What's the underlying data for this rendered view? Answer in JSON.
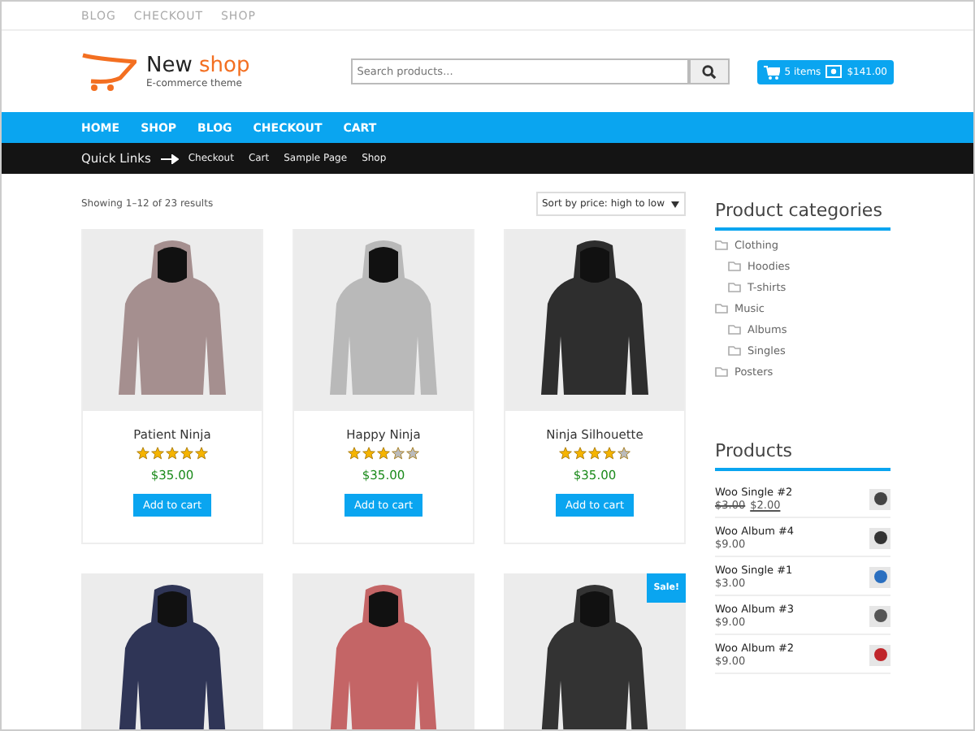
{
  "top_links": [
    "BLOG",
    "CHECKOUT",
    "SHOP"
  ],
  "logo": {
    "title_start": "New",
    "title_end": "shop",
    "tagline": "E-commerce theme"
  },
  "search": {
    "placeholder": "Search products..."
  },
  "cart": {
    "items": "5 items",
    "total": "$141.00"
  },
  "nav": [
    "HOME",
    "SHOP",
    "BLOG",
    "CHECKOUT",
    "CART"
  ],
  "quick_links": {
    "label": "Quick Links",
    "links": [
      "Checkout",
      "Cart",
      "Sample Page",
      "Shop"
    ]
  },
  "results": "Showing 1–12 of 23 results",
  "sort": {
    "value": "Sort by price: high to low"
  },
  "products": [
    {
      "name": "Patient Ninja",
      "stars": 5,
      "price": "$35.00",
      "button": "Add to cart",
      "color": "#a58f8f"
    },
    {
      "name": "Happy Ninja",
      "stars": 3,
      "price": "$35.00",
      "button": "Add to cart",
      "color": "#b9b9b9"
    },
    {
      "name": "Ninja Silhouette",
      "stars": 4,
      "price": "$35.00",
      "button": "Add to cart",
      "color": "#2e2e2e"
    },
    {
      "color": "#2f3556"
    },
    {
      "color": "#c46566"
    },
    {
      "color": "#333333",
      "badge": "Sale!"
    }
  ],
  "categories": {
    "title": "Product categories",
    "items": [
      {
        "label": "Clothing",
        "children": [
          {
            "label": "Hoodies"
          },
          {
            "label": "T-shirts"
          }
        ]
      },
      {
        "label": "Music",
        "children": [
          {
            "label": "Albums"
          },
          {
            "label": "Singles"
          }
        ]
      },
      {
        "label": "Posters"
      }
    ]
  },
  "widget_products": {
    "title": "Products",
    "items": [
      {
        "name": "Woo Single #2",
        "old_price": "$3.00",
        "price": "$2.00",
        "color": "#444444"
      },
      {
        "name": "Woo Album #4",
        "price": "$9.00",
        "color": "#333333"
      },
      {
        "name": "Woo Single #1",
        "price": "$3.00",
        "color": "#2a6fc0"
      },
      {
        "name": "Woo Album #3",
        "price": "$9.00",
        "color": "#555555"
      },
      {
        "name": "Woo Album #2",
        "price": "$9.00",
        "color": "#c0262b"
      }
    ]
  }
}
